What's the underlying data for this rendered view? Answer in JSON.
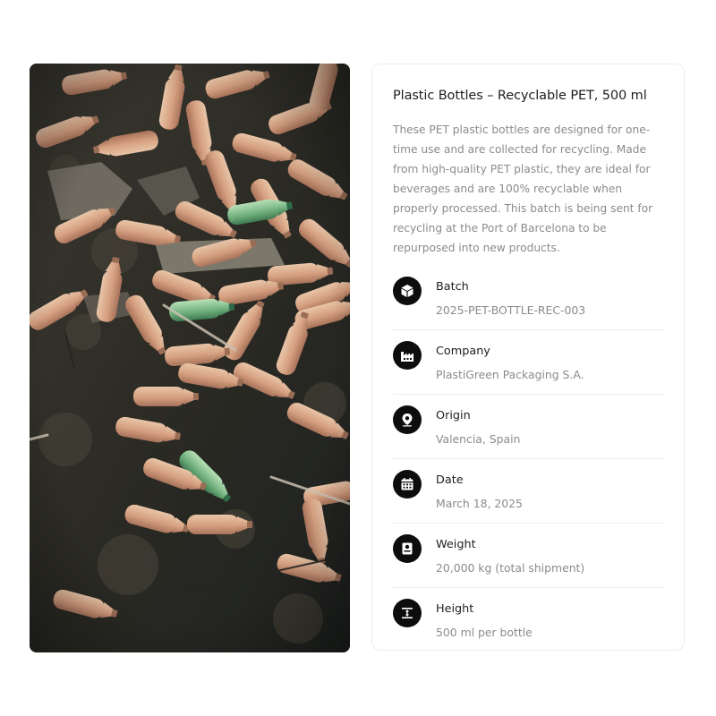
{
  "photo": {
    "alt_subject": "plastic bottles on dark ground"
  },
  "product": {
    "title": "Plastic Bottles – Recyclable PET, 500 ml",
    "description": "These PET plastic bottles are designed for one-time use and are collected for recycling. Made from high-quality PET plastic, they are ideal for beverages and are 100% recyclable when properly processed. This batch is being sent for recycling at the Port of Barcelona to be repurposed into new products."
  },
  "details": [
    {
      "icon": "box-icon",
      "label": "Batch",
      "value": "2025-PET-BOTTLE-REC-003"
    },
    {
      "icon": "factory-icon",
      "label": "Company",
      "value": "PlastiGreen Packaging S.A."
    },
    {
      "icon": "location-pin-icon",
      "label": "Origin",
      "value": "Valencia, Spain"
    },
    {
      "icon": "calendar-icon",
      "label": "Date",
      "value": "March 18, 2025"
    },
    {
      "icon": "weight-icon",
      "label": "Weight",
      "value": "20,000 kg (total shipment)"
    },
    {
      "icon": "height-icon",
      "label": "Height",
      "value": "500 ml per bottle"
    }
  ],
  "colors": {
    "icon_bg": "#0d0d0d",
    "title": "#1e1e1e",
    "muted_text": "#8b8b8b",
    "divider": "#ececec"
  }
}
